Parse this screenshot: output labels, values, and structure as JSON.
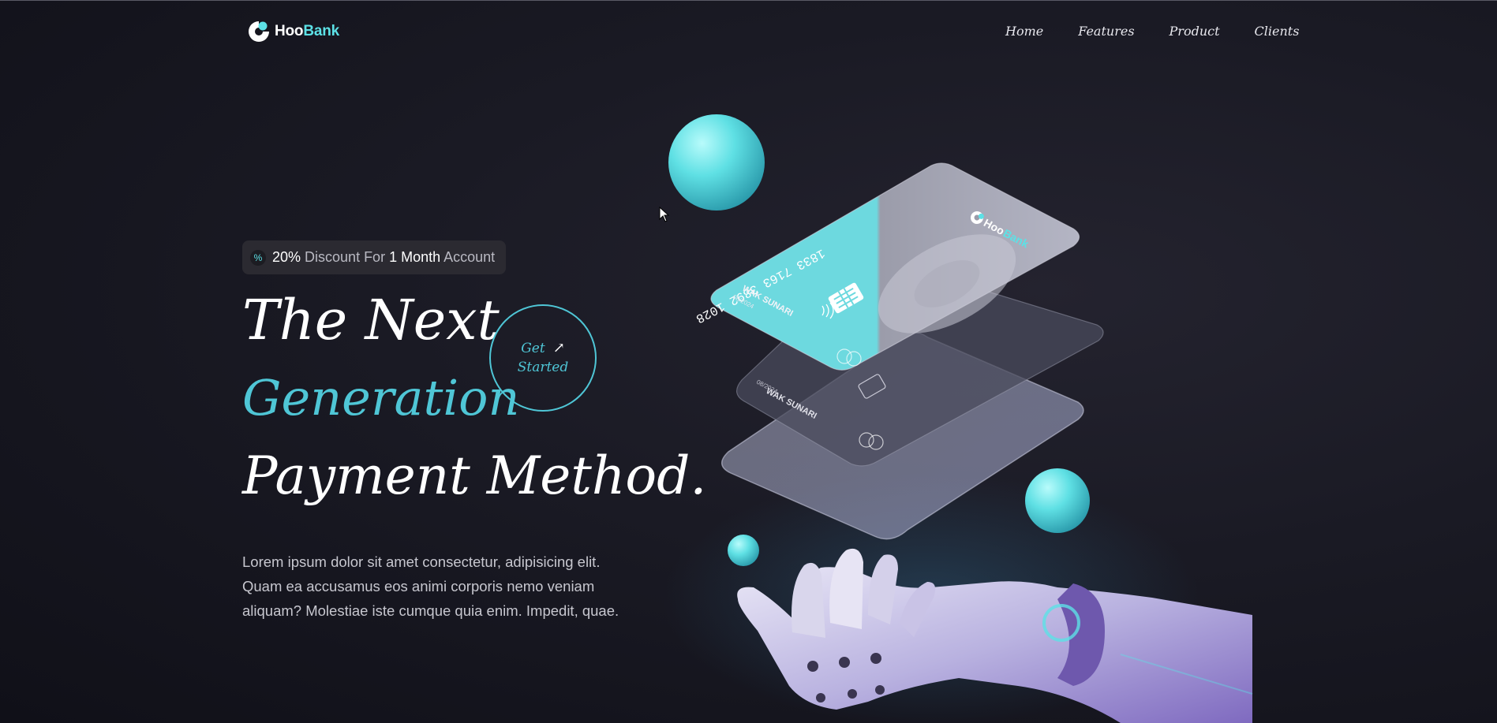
{
  "brand": {
    "name_part1": "Hoo",
    "name_part2": "Bank"
  },
  "nav": {
    "items": [
      "Home",
      "Features",
      "Product",
      "Clients"
    ]
  },
  "badge": {
    "icon": "percent-icon",
    "pct": "20%",
    "t1": " Discount For ",
    "t2": "1 Month",
    "t3": " Account"
  },
  "hero": {
    "line1": "The Next",
    "line2": "Generation",
    "line3": "Payment Method.",
    "paragraph": "Lorem ipsum dolor sit amet consectetur, adipisicing elit. Quam ea accusamus eos animi corporis nemo veniam aliquam? Molestiae iste cumque quia enim. Impedit, quae."
  },
  "cta": {
    "line1": "Get",
    "line2": "Started",
    "icon": "arrow-up-right-icon"
  },
  "cards": {
    "number": "1833 7163 3892 1028",
    "holder": "WAK SUNARI",
    "expiry": "08/2024",
    "card_brand_1": "Hoo",
    "card_brand_2": "Bank"
  },
  "colors": {
    "accent": "#5ce1e6",
    "accent_text": "#4fc6d6",
    "background": "#1a1a24"
  }
}
